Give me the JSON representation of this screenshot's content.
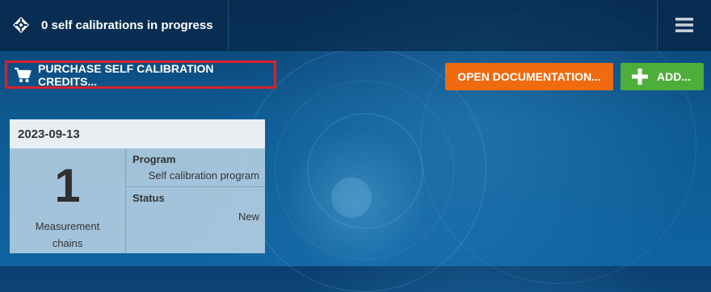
{
  "header": {
    "status_text": "0 self calibrations in progress",
    "status_icon": "crosshair-diamond-icon",
    "menu_icon": "hamburger-menu-icon"
  },
  "toolbar": {
    "purchase_label": "PURCHASE SELF CALIBRATION CREDITS...",
    "purchase_icon": "cart-icon",
    "documentation_label": "OPEN DOCUMENTATION...",
    "add_label": "ADD...",
    "add_icon": "plus-icon"
  },
  "colors": {
    "orange": "#f06a0f",
    "green": "#4eae3b",
    "highlight": "#d8232a",
    "header_dark": "#082d52"
  },
  "cards": [
    {
      "date": "2023-09-13",
      "count": "1",
      "count_label": "Measurement chains",
      "program_label": "Program",
      "program_value": "Self calibration program",
      "status_label": "Status",
      "status_value": "New"
    }
  ]
}
